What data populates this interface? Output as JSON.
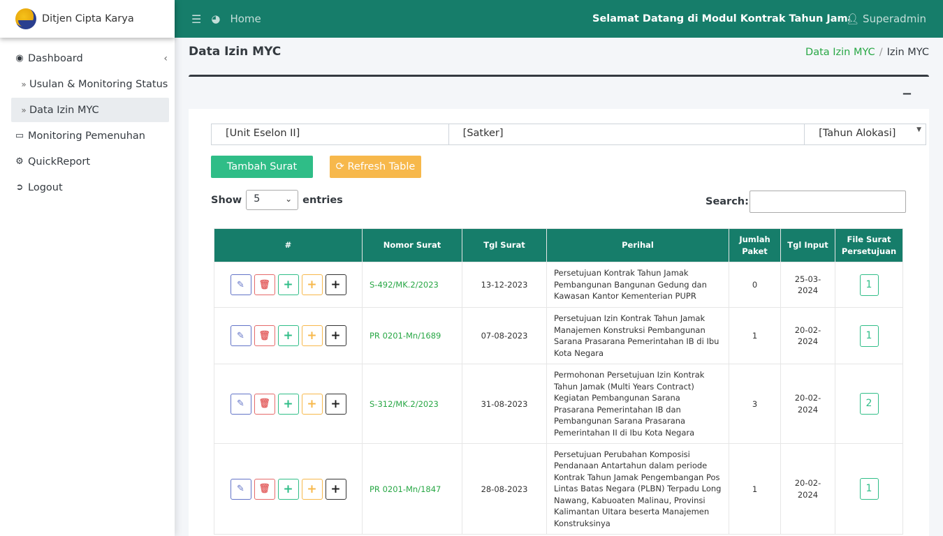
{
  "brand": {
    "name": "Ditjen Cipta Karya"
  },
  "sidebar": {
    "items": [
      {
        "label": "Dashboard",
        "icon": "dashboard-icon",
        "glyph": "◉"
      },
      {
        "label": "Usulan & Monitoring Status",
        "icon": "angle-double-right-icon",
        "glyph": "»"
      },
      {
        "label": "Data Izin MYC",
        "icon": "angle-double-right-icon",
        "glyph": "»"
      },
      {
        "label": "Monitoring Pemenuhan",
        "icon": "desktop-icon",
        "glyph": "▭"
      },
      {
        "label": "QuickReport",
        "icon": "cogs-icon",
        "glyph": "⚙"
      },
      {
        "label": "Logout",
        "icon": "logout-icon",
        "glyph": "➲"
      }
    ],
    "chevron": "‹"
  },
  "topbar": {
    "home": "Home",
    "marquee": "Selamat Datang di Modul Kontrak Tahun Jamak [KTJ] Ditjen Cipta Karya",
    "user": "Superadmin"
  },
  "page": {
    "title": "Data Izin MYC"
  },
  "breadcrumb": {
    "link": "Data Izin MYC",
    "sep": "/",
    "current": "Izin MYC"
  },
  "card": {
    "collapse": "−"
  },
  "filters": {
    "unit": "[Unit Eselon II]",
    "satker": "[Satker]",
    "tahun": "[Tahun Alokasi]"
  },
  "buttons": {
    "tambah": "Tambah Surat",
    "refresh": "Refresh Table"
  },
  "datatable": {
    "show": "Show",
    "entries_value": "5",
    "entries": "entries",
    "search": "Search:"
  },
  "table": {
    "headers": [
      "#",
      "Nomor Surat",
      "Tgl Surat",
      "Perihal",
      "Jumlah Paket",
      "Tgl Input",
      "File Surat Persetujuan"
    ],
    "rows": [
      {
        "nomor": "S-492/MK.2/2023",
        "tgl": "13-12-2023",
        "perihal": "Persetujuan Kontrak Tahun Jamak Pembangunan Bangunan Gedung dan Kawasan Kantor Kementerian PUPR",
        "jumlah": "0",
        "input": "25-03-2024",
        "file": "1"
      },
      {
        "nomor": "PR 0201-Mn/1689",
        "tgl": "07-08-2023",
        "perihal": "Persetujuan Izin Kontrak Tahun Jamak Manajemen Konstruksi Pembangunan Sarana Prasarana Pemerintahan IB di Ibu Kota Negara",
        "jumlah": "1",
        "input": "20-02-2024",
        "file": "1"
      },
      {
        "nomor": "S-312/MK.2/2023",
        "tgl": "31-08-2023",
        "perihal": "Permohonan Persetujuan Izin Kontrak Tahun Jamak (Multi Years Contract) Kegiatan Pembangunan Sarana Prasarana Pemerintahan IB dan Pembangunan Sarana Prasarana Pemerintahan II di Ibu Kota Negara",
        "jumlah": "3",
        "input": "20-02-2024",
        "file": "2"
      },
      {
        "nomor": "PR 0201-Mn/1847",
        "tgl": "28-08-2023",
        "perihal": "Persetujuan Perubahan Komposisi Pendanaan Antartahun dalam periode Kontrak Tahun Jamak Pengembangan Pos Lintas Batas Negara (PLBN) Terpadu Long Nawang, Kabuoaten Malinau, Provinsi Kalimantan UItara beserta Manajemen Konstruksinya",
        "jumlah": "1",
        "input": "20-02-2024",
        "file": "1"
      }
    ]
  },
  "colors": {
    "primary": "#167d6a",
    "success": "#2fbd87",
    "warning": "#f7b84b",
    "danger": "#e56a6a",
    "edit": "#6273c7"
  }
}
